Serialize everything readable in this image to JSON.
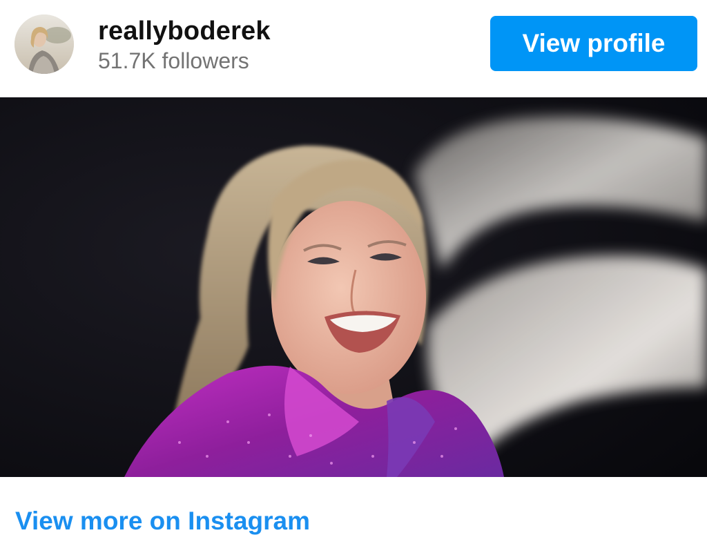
{
  "post": {
    "username": "reallyboderek",
    "followers": "51.7K followers",
    "view_profile_label": "View profile",
    "view_more_label": "View more on Instagram"
  },
  "colors": {
    "accent_button": "#0095f6",
    "link": "#1a8ff0",
    "username": "#111111",
    "secondary_text": "#737373"
  },
  "icons": {
    "avatar": "profile-photo",
    "photo": "post-image"
  }
}
